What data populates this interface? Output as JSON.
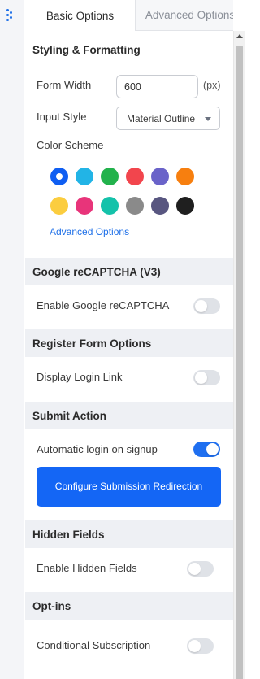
{
  "tabs": {
    "basic": "Basic Options",
    "advanced": "Advanced Options"
  },
  "styling": {
    "title": "Styling & Formatting",
    "form_width_label": "Form Width",
    "form_width_value": "600",
    "form_width_unit": "(px)",
    "input_style_label": "Input Style",
    "input_style_value": "Material Outline",
    "color_scheme_label": "Color Scheme",
    "colors": [
      "#0f5ef2",
      "#22b4e6",
      "#22b24c",
      "#f2454d",
      "#6a63c9",
      "#f77f0f",
      "#fbcd3f",
      "#e8347a",
      "#14c2aa",
      "#8a8a8a",
      "#585680",
      "#1f1f1f"
    ],
    "selected_color": "#0f5ef2",
    "advanced_link": "Advanced Options"
  },
  "recaptcha": {
    "title": "Google reCAPTCHA (V3)",
    "enable_label": "Enable Google reCAPTCHA",
    "enabled": false
  },
  "register": {
    "title": "Register Form Options",
    "login_link_label": "Display Login Link",
    "enabled": false
  },
  "submit": {
    "title": "Submit Action",
    "auto_login_label": "Automatic login on signup",
    "enabled": true,
    "button_label": "Configure Submission Redirection"
  },
  "hidden": {
    "title": "Hidden Fields",
    "enable_label": "Enable Hidden Fields",
    "enabled": false
  },
  "optins": {
    "title": "Opt-ins",
    "conditional_label": "Conditional Subscription",
    "enabled": false
  },
  "icons": {
    "rail": "grip-dots-icon",
    "caret": "caret-down-icon",
    "scroll": "scroll-up-icon"
  },
  "theme": {
    "accent": "#1f6ff0",
    "section_bg": "#eef0f4"
  }
}
